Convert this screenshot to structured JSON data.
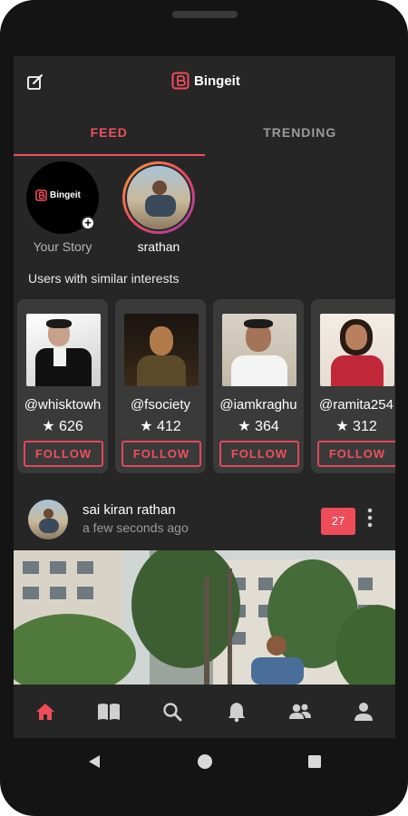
{
  "app": {
    "title": "Bingeit",
    "logo_mark": "B"
  },
  "tabs": [
    {
      "label": "FEED",
      "active": true
    },
    {
      "label": "TRENDING",
      "active": false
    }
  ],
  "stories": [
    {
      "label": "Your Story",
      "logo_text": "Bingeit"
    },
    {
      "label": "srathan"
    }
  ],
  "similar": {
    "title": "Users with similar interests",
    "users": [
      {
        "handle": "@whisktowh",
        "score": "626",
        "follow_label": "FOLLOW"
      },
      {
        "handle": "@fsociety",
        "score": "412",
        "follow_label": "FOLLOW"
      },
      {
        "handle": "@iamkraghu",
        "score": "364",
        "follow_label": "FOLLOW"
      },
      {
        "handle": "@ramita254",
        "score": "312",
        "follow_label": "FOLLOW"
      }
    ]
  },
  "post": {
    "author": "sai kiran rathan",
    "time": "a few seconds ago",
    "badge": "27"
  },
  "nav": [
    "home-icon",
    "book-icon",
    "search-icon",
    "bell-icon",
    "people-icon",
    "profile-icon"
  ],
  "colors": {
    "accent": "#ef4c5a",
    "background": "#262626",
    "card": "#3a3a3a"
  }
}
